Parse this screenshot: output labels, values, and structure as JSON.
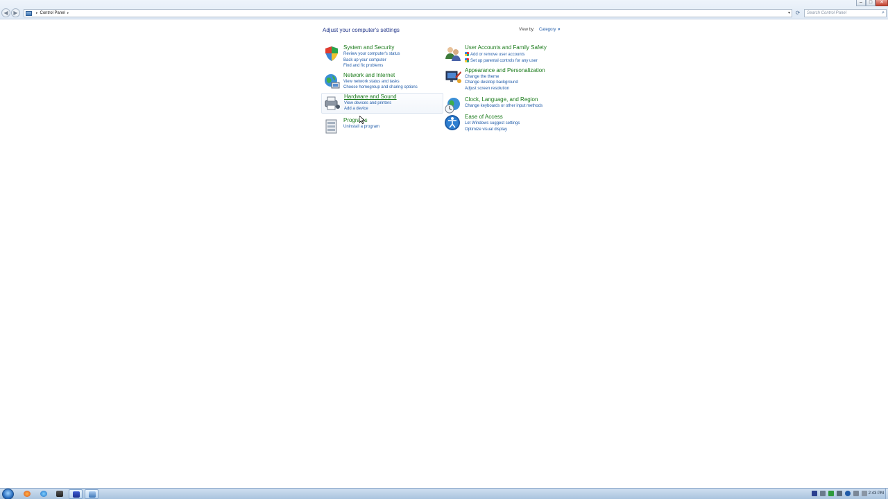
{
  "window": {
    "controls": {
      "minimize": "–",
      "maximize": "□",
      "close": "✕"
    },
    "nav": {
      "back": "◀",
      "forward": "▶"
    }
  },
  "address": {
    "crumbs": [
      "Control Panel"
    ],
    "separator": "▸",
    "dropdown": "▾",
    "refresh": "⟳"
  },
  "search": {
    "placeholder": "Search Control Panel",
    "icon": "search-icon"
  },
  "page": {
    "heading": "Adjust your computer's settings",
    "view_by_label": "View by:",
    "view_by_value": "Category"
  },
  "categories": [
    {
      "title": "System and Security",
      "icon": "shield-system-icon",
      "links": [
        "Review your computer's status",
        "Back up your computer",
        "Find and fix problems"
      ]
    },
    {
      "title": "Network and Internet",
      "icon": "globe-network-icon",
      "links": [
        "View network status and tasks",
        "Choose homegroup and sharing options"
      ]
    },
    {
      "title": "Hardware and Sound",
      "icon": "printer-hardware-icon",
      "links": [
        "View devices and printers",
        "Add a device"
      ]
    },
    {
      "title": "Programs",
      "icon": "programs-icon",
      "links": [
        "Uninstall a program"
      ]
    },
    {
      "title": "User Accounts and Family Safety",
      "icon": "users-icon",
      "links": [
        "Add or remove user accounts",
        "Set up parental controls for any user"
      ]
    },
    {
      "title": "Appearance and Personalization",
      "icon": "monitor-paint-icon",
      "links": [
        "Change the theme",
        "Change desktop background",
        "Adjust screen resolution"
      ]
    },
    {
      "title": "Clock, Language, and Region",
      "icon": "globe-clock-icon",
      "links": [
        "Change keyboards or other input methods"
      ]
    },
    {
      "title": "Ease of Access",
      "icon": "ease-of-access-icon",
      "links": [
        "Let Windows suggest settings",
        "Optimize visual display"
      ]
    }
  ],
  "taskbar": {
    "clock": "2:43 PM",
    "items": [
      "firefox-icon",
      "ie-icon",
      "app-icon",
      "paint-icon",
      "control-panel-icon"
    ]
  },
  "colors": {
    "category_title": "#1a7a1a",
    "link": "#1e5aa8",
    "heading": "#1e3287"
  }
}
